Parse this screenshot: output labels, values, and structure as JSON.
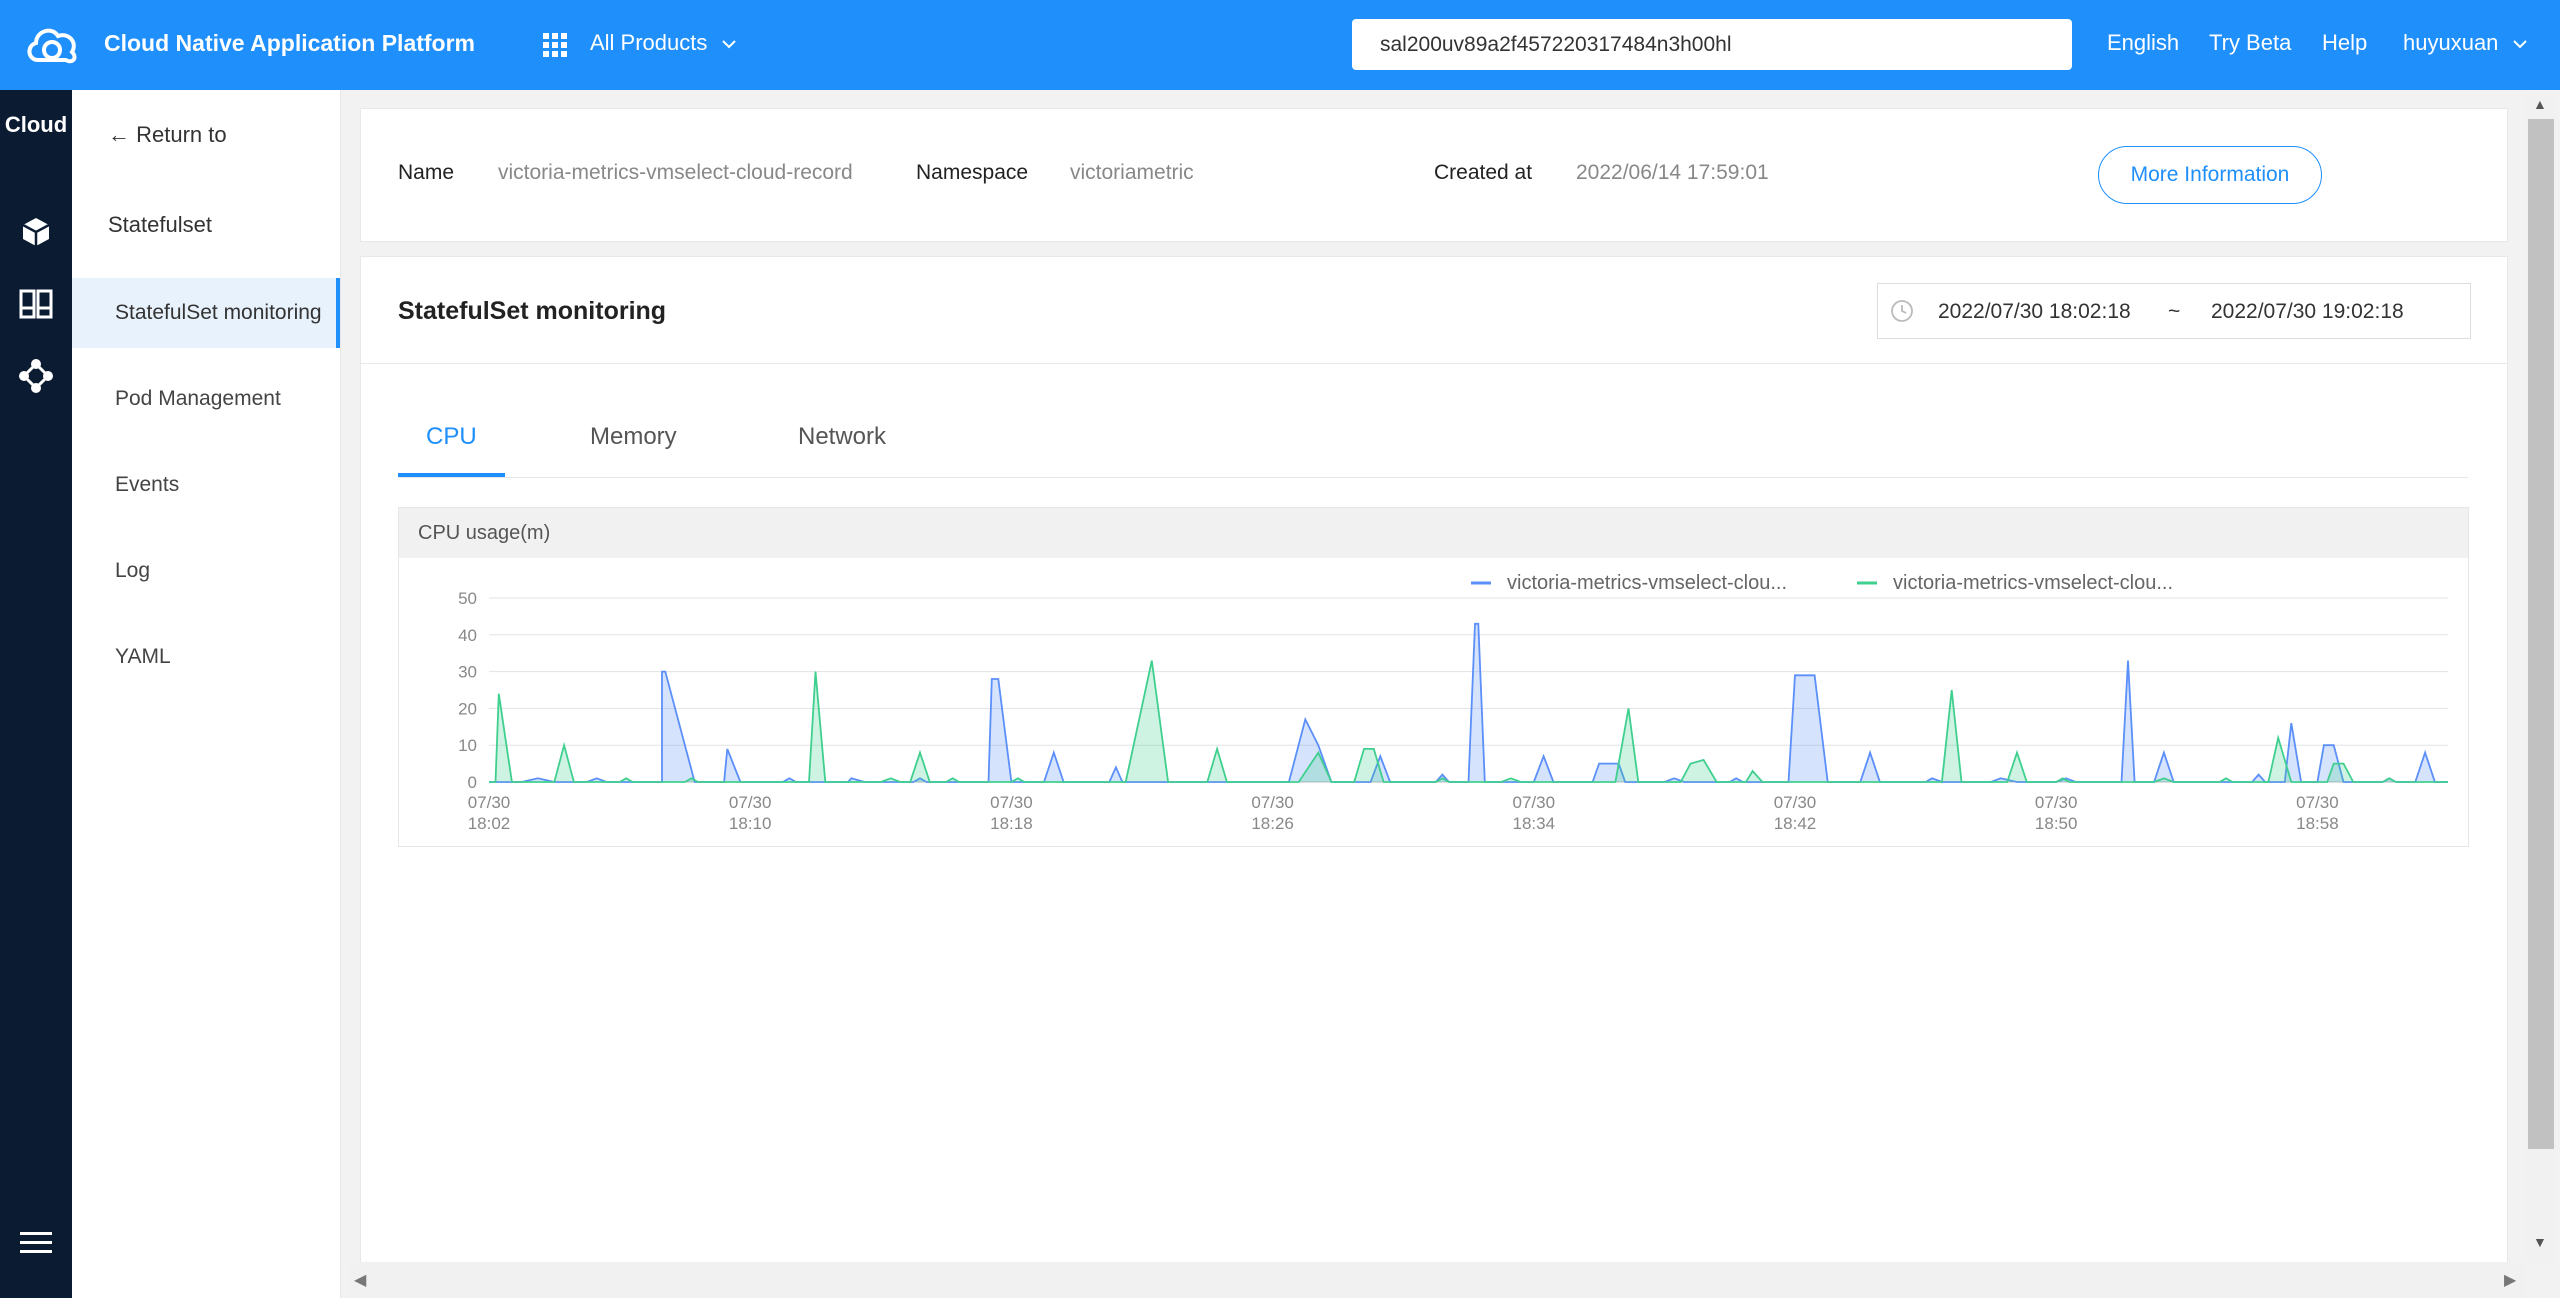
{
  "topbar": {
    "app_title": "Cloud Native Application Platform",
    "products_label": "All Products",
    "search_value": "sal200uv89a2f457220317484n3h00hl",
    "lang_label": "English",
    "beta_label": "Try Beta",
    "help_label": "Help",
    "user_label": "huyuxuan",
    "chevron": "⌄"
  },
  "rail": {
    "title": "Cloud",
    "icons": [
      "cube-icon",
      "columns-icon",
      "network-icon",
      "menu-icon"
    ]
  },
  "sidebar": {
    "back_label": "← Return to",
    "section_label": "Statefulset",
    "items": [
      {
        "label": "StatefulSet monitoring",
        "active": true
      },
      {
        "label": "Pod Management",
        "active": false
      },
      {
        "label": "Events",
        "active": false
      },
      {
        "label": "Log",
        "active": false
      },
      {
        "label": "YAML",
        "active": false
      }
    ]
  },
  "info": {
    "name_label": "Name",
    "name_value": "victoria-metrics-vmselect-cloud-record",
    "namespace_label": "Namespace",
    "namespace_value": "victoriametric",
    "created_label": "Created at",
    "created_value": "2022/06/14 17:59:01",
    "more_button": "More Information"
  },
  "monitoring": {
    "title": "StatefulSet monitoring",
    "range_start": "2022/07/30 18:02:18",
    "range_sep": "~",
    "range_end": "2022/07/30 19:02:18",
    "tabs": [
      {
        "label": "CPU",
        "active": true
      },
      {
        "label": "Memory",
        "active": false
      },
      {
        "label": "Network",
        "active": false
      }
    ],
    "chart_title": "CPU usage(m)"
  },
  "colors": {
    "accent": "#1f8ffb",
    "series_blue": "#5b8ff9",
    "series_green": "#3fcf8e"
  },
  "chart_data": {
    "type": "area",
    "title": "CPU usage(m)",
    "ylim": [
      0,
      50
    ],
    "yticks": [
      0,
      10,
      20,
      30,
      40,
      50
    ],
    "x_tick_labels": [
      [
        "07/30",
        "18:02"
      ],
      [
        "07/30",
        "18:10"
      ],
      [
        "07/30",
        "18:18"
      ],
      [
        "07/30",
        "18:26"
      ],
      [
        "07/30",
        "18:34"
      ],
      [
        "07/30",
        "18:42"
      ],
      [
        "07/30",
        "18:50"
      ],
      [
        "07/30",
        "18:58"
      ]
    ],
    "x_tick_minutes": [
      0,
      8,
      16,
      24,
      32,
      40,
      48,
      56
    ],
    "x_range_minutes": [
      0,
      60
    ],
    "legend_position": "top-center",
    "series": [
      {
        "name": "victoria-metrics-vmselect-clou...",
        "color": "#5b8ff9",
        "points": [
          [
            0,
            0
          ],
          [
            1.0,
            0
          ],
          [
            1.5,
            1
          ],
          [
            2.0,
            0
          ],
          [
            3.0,
            0
          ],
          [
            3.3,
            1
          ],
          [
            3.6,
            0
          ],
          [
            5.3,
            0
          ],
          [
            5.3,
            30
          ],
          [
            5.4,
            30
          ],
          [
            6.3,
            0
          ],
          [
            7.2,
            0
          ],
          [
            7.3,
            9
          ],
          [
            7.7,
            0
          ],
          [
            9.0,
            0
          ],
          [
            9.2,
            1
          ],
          [
            9.4,
            0
          ],
          [
            11.0,
            0
          ],
          [
            11.1,
            1
          ],
          [
            11.5,
            0
          ],
          [
            13.0,
            0
          ],
          [
            13.2,
            1
          ],
          [
            13.4,
            0
          ],
          [
            15.3,
            0
          ],
          [
            15.4,
            28
          ],
          [
            15.6,
            28
          ],
          [
            16.0,
            0
          ],
          [
            17.0,
            0
          ],
          [
            17.3,
            8
          ],
          [
            17.6,
            0
          ],
          [
            19.0,
            0
          ],
          [
            19.2,
            4
          ],
          [
            19.4,
            0
          ],
          [
            24.5,
            0
          ],
          [
            25.0,
            17
          ],
          [
            25.4,
            10
          ],
          [
            25.8,
            0
          ],
          [
            27.0,
            0
          ],
          [
            27.3,
            7
          ],
          [
            27.6,
            0
          ],
          [
            29.0,
            0
          ],
          [
            29.2,
            2
          ],
          [
            29.4,
            0
          ],
          [
            30.0,
            0
          ],
          [
            30.2,
            43
          ],
          [
            30.3,
            43
          ],
          [
            30.5,
            0
          ],
          [
            32.0,
            0
          ],
          [
            32.3,
            7
          ],
          [
            32.6,
            0
          ],
          [
            33.8,
            0
          ],
          [
            34.0,
            5
          ],
          [
            34.6,
            5
          ],
          [
            34.8,
            0
          ],
          [
            36.0,
            0
          ],
          [
            36.3,
            1
          ],
          [
            36.6,
            0
          ],
          [
            38.0,
            0
          ],
          [
            38.2,
            1
          ],
          [
            38.4,
            0
          ],
          [
            39.8,
            0
          ],
          [
            40.0,
            29
          ],
          [
            40.6,
            29
          ],
          [
            41.0,
            0
          ],
          [
            42.0,
            0
          ],
          [
            42.3,
            8
          ],
          [
            42.6,
            0
          ],
          [
            44.0,
            0
          ],
          [
            44.2,
            1
          ],
          [
            44.5,
            0
          ],
          [
            46.0,
            0
          ],
          [
            46.3,
            1
          ],
          [
            46.8,
            0
          ],
          [
            48.0,
            0
          ],
          [
            48.3,
            1
          ],
          [
            48.6,
            0
          ],
          [
            50.0,
            0
          ],
          [
            50.2,
            33
          ],
          [
            50.4,
            0
          ],
          [
            51.0,
            0
          ],
          [
            51.3,
            8
          ],
          [
            51.6,
            0
          ],
          [
            54.0,
            0
          ],
          [
            54.2,
            2
          ],
          [
            54.4,
            0
          ],
          [
            55.0,
            0
          ],
          [
            55.2,
            16
          ],
          [
            55.5,
            0
          ],
          [
            56.0,
            0
          ],
          [
            56.2,
            10
          ],
          [
            56.5,
            10
          ],
          [
            56.8,
            0
          ],
          [
            58.0,
            0
          ],
          [
            58.2,
            1
          ],
          [
            58.4,
            0
          ],
          [
            59.0,
            0
          ],
          [
            59.3,
            8
          ],
          [
            59.6,
            0
          ],
          [
            60,
            0
          ]
        ]
      },
      {
        "name": "victoria-metrics-vmselect-clou...",
        "color": "#3fcf8e",
        "points": [
          [
            0,
            0
          ],
          [
            0.2,
            0
          ],
          [
            0.3,
            24
          ],
          [
            0.7,
            0
          ],
          [
            2.0,
            0
          ],
          [
            2.3,
            10
          ],
          [
            2.6,
            0
          ],
          [
            4.0,
            0
          ],
          [
            4.2,
            1
          ],
          [
            4.4,
            0
          ],
          [
            6.0,
            0
          ],
          [
            6.2,
            1
          ],
          [
            6.4,
            0
          ],
          [
            9.8,
            0
          ],
          [
            10.0,
            30
          ],
          [
            10.3,
            0
          ],
          [
            12.0,
            0
          ],
          [
            12.3,
            1
          ],
          [
            12.6,
            0
          ],
          [
            12.9,
            0
          ],
          [
            13.2,
            8
          ],
          [
            13.5,
            0
          ],
          [
            14.0,
            0
          ],
          [
            14.2,
            1
          ],
          [
            14.4,
            0
          ],
          [
            16.0,
            0
          ],
          [
            16.2,
            1
          ],
          [
            16.4,
            0
          ],
          [
            19.5,
            0
          ],
          [
            20.3,
            33
          ],
          [
            20.8,
            0
          ],
          [
            22.0,
            0
          ],
          [
            22.3,
            9
          ],
          [
            22.6,
            0
          ],
          [
            24.8,
            0
          ],
          [
            25.4,
            8
          ],
          [
            25.8,
            0
          ],
          [
            26.5,
            0
          ],
          [
            26.8,
            9
          ],
          [
            27.1,
            9
          ],
          [
            27.4,
            0
          ],
          [
            29.0,
            0
          ],
          [
            29.2,
            1
          ],
          [
            29.4,
            0
          ],
          [
            31.0,
            0
          ],
          [
            31.3,
            1
          ],
          [
            31.6,
            0
          ],
          [
            34.5,
            0
          ],
          [
            34.9,
            20
          ],
          [
            35.2,
            0
          ],
          [
            36.5,
            0
          ],
          [
            36.8,
            5
          ],
          [
            37.2,
            6
          ],
          [
            37.6,
            0
          ],
          [
            38.5,
            0
          ],
          [
            38.7,
            3
          ],
          [
            39.0,
            0
          ],
          [
            44.5,
            0
          ],
          [
            44.8,
            25
          ],
          [
            45.1,
            0
          ],
          [
            46.5,
            0
          ],
          [
            46.8,
            8
          ],
          [
            47.1,
            0
          ],
          [
            48.0,
            0
          ],
          [
            48.2,
            1
          ],
          [
            48.4,
            0
          ],
          [
            51.0,
            0
          ],
          [
            51.3,
            1
          ],
          [
            51.6,
            0
          ],
          [
            53.0,
            0
          ],
          [
            53.2,
            1
          ],
          [
            53.4,
            0
          ],
          [
            54.5,
            0
          ],
          [
            54.8,
            12
          ],
          [
            55.2,
            0
          ],
          [
            56.3,
            0
          ],
          [
            56.5,
            5
          ],
          [
            56.8,
            5
          ],
          [
            57.1,
            0
          ],
          [
            58.0,
            0
          ],
          [
            58.2,
            1
          ],
          [
            58.4,
            0
          ],
          [
            60,
            0
          ]
        ]
      }
    ]
  }
}
